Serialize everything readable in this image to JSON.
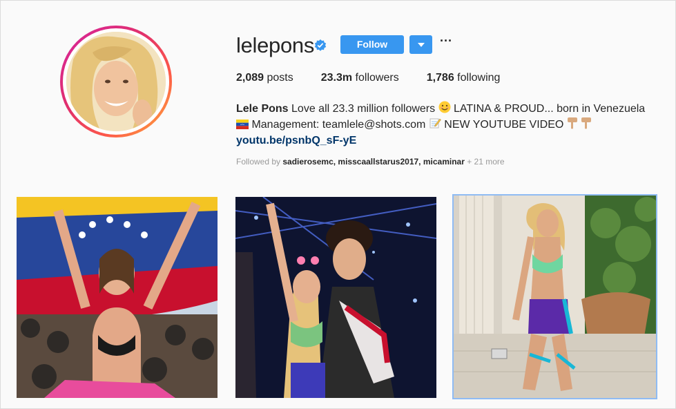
{
  "profile": {
    "username": "lelepons",
    "follow_label": "Follow",
    "more_label": "···",
    "stats": {
      "posts_count": "2,089",
      "posts_label": " posts",
      "followers_count": "23.3m",
      "followers_label": " followers",
      "following_count": "1,786",
      "following_label": " following"
    },
    "bio": {
      "name": "Lele Pons",
      "line1": " Love all 23.3 million followers ",
      "line1b": " LATINA & PROUD... born in Venezuela",
      "line2": " Management: teamlele@shots.com ",
      "line2b": " NEW YOUTUBE VIDEO ",
      "link": "youtu.be/psnbQ_sF-yE"
    },
    "followed_by": {
      "prefix": "Followed by ",
      "users": "sadierosemc, misscaallstarus2017, micaminar",
      "suffix": " + 21 more"
    }
  },
  "colors": {
    "follow_blue": "#3897f0",
    "link_blue": "#003569",
    "ring_start": "#d6249f",
    "ring_end": "#fdb13b"
  },
  "icons": [
    "verified-badge-icon",
    "chevron-down-icon",
    "more-options-icon",
    "smile-emoji-icon",
    "venezuela-flag-icon",
    "memo-emoji-icon",
    "pointing-down-emoji-icon"
  ]
}
